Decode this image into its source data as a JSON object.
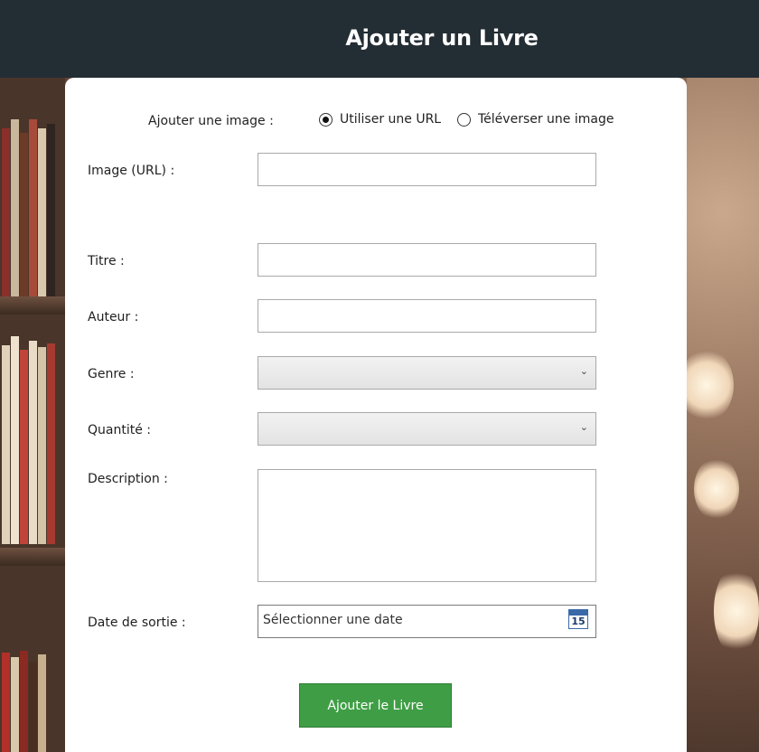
{
  "header": {
    "title": "Ajouter un Livre"
  },
  "form": {
    "image_mode_label": "Ajouter une image :",
    "image_mode_options": [
      {
        "label": "Utiliser une URL",
        "checked": true
      },
      {
        "label": "Téléverser une image",
        "checked": false
      }
    ],
    "image_url_label": "Image (URL) :",
    "image_url_value": "",
    "title_label": "Titre :",
    "title_value": "",
    "author_label": "Auteur :",
    "author_value": "",
    "genre_label": "Genre :",
    "genre_value": "",
    "quantity_label": "Quantité :",
    "quantity_value": "",
    "description_label": "Description :",
    "description_value": "",
    "release_date_label": "Date de sortie :",
    "release_date_placeholder": "Sélectionner une date",
    "calendar_day": "15",
    "submit_label": "Ajouter le Livre"
  },
  "icons": {
    "select_chevron": "chevron-down-icon",
    "calendar": "calendar-icon"
  },
  "colors": {
    "header_bg": "#232d34",
    "submit_bg": "#3f9e45",
    "card_bg": "#ffffff"
  }
}
